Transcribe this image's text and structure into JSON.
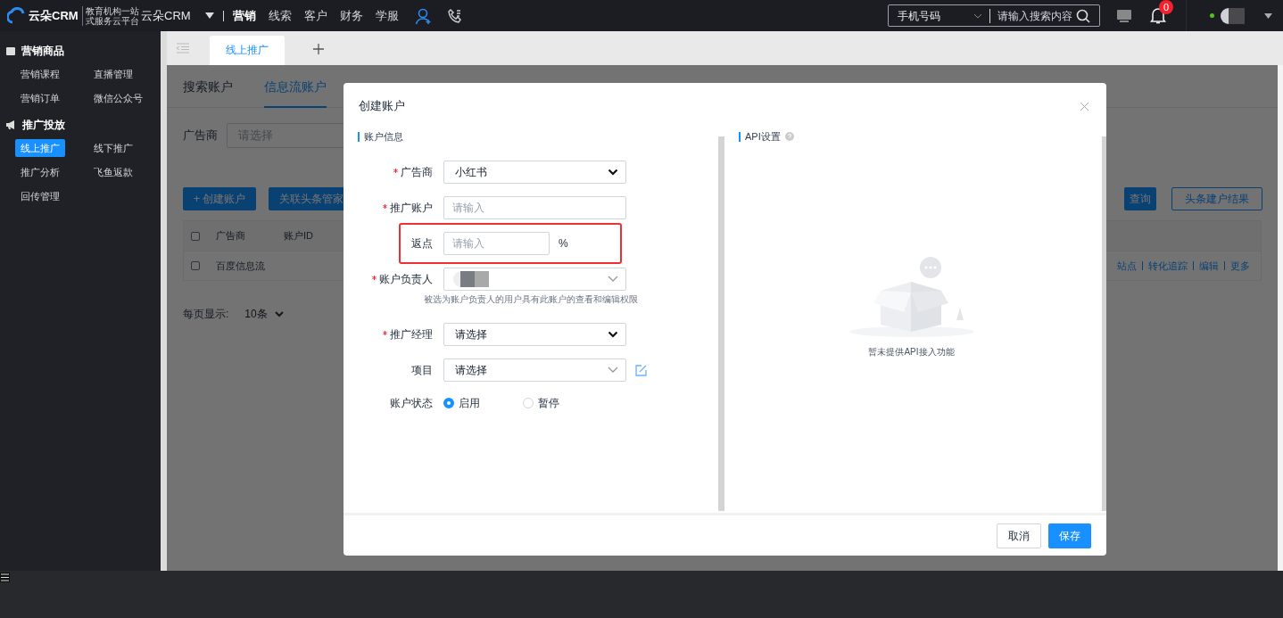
{
  "topbar": {
    "logo": "云朵CRM",
    "slogan": [
      "教育机构一站",
      "式服务云平台"
    ],
    "product": "云朵CRM",
    "nav": [
      {
        "label": "营销",
        "selected": true
      },
      {
        "label": "线索",
        "selected": false
      },
      {
        "label": "客户",
        "selected": false
      },
      {
        "label": "财务",
        "selected": false
      },
      {
        "label": "学服",
        "selected": false
      }
    ],
    "search": {
      "type": "手机号码",
      "placeholder": "请输入搜索内容"
    },
    "notifications": "0",
    "online": true
  },
  "sidebar": {
    "groups": [
      {
        "title": "营销商品",
        "items": [
          {
            "label": "营销课程",
            "selected": false
          },
          {
            "label": "直播管理",
            "selected": false
          },
          {
            "label": "营销订单",
            "selected": false
          },
          {
            "label": "微信公众号",
            "selected": false
          }
        ]
      },
      {
        "title": "推广投放",
        "items": [
          {
            "label": "线上推广",
            "selected": true
          },
          {
            "label": "线下推广",
            "selected": false
          },
          {
            "label": "推广分析",
            "selected": false
          },
          {
            "label": "飞鱼返款",
            "selected": false
          },
          {
            "label": "回传管理",
            "selected": false
          }
        ]
      }
    ]
  },
  "page_tabs": [
    {
      "label": "线上推广",
      "selected": true
    }
  ],
  "page": {
    "tabs": [
      {
        "label": "搜索账户",
        "selected": false
      },
      {
        "label": "信息流账户",
        "selected": true
      }
    ],
    "filter": {
      "label": "广告商",
      "placeholder": "请选择"
    },
    "left_buttons": [
      {
        "label": "+ 创建账户",
        "kind": "primary"
      },
      {
        "label": "关联头条管家",
        "kind": "primary"
      }
    ],
    "right_buttons": [
      {
        "label": "查询",
        "kind": "primary"
      },
      {
        "label": "头条建户结果",
        "kind": "outline"
      }
    ],
    "table": {
      "all_checked": false,
      "columns": [
        "广告商",
        "账户ID"
      ],
      "rows": [
        {
          "checked": false,
          "cells": [
            "百度信息流"
          ],
          "actions": [
            "站点",
            "转化追踪",
            "编辑",
            "更多"
          ]
        }
      ]
    },
    "page_size": {
      "label": "每页显示:",
      "value": "10条"
    }
  },
  "modal": {
    "title": "创建账户",
    "left_section": "账户信息",
    "right_section": "API设置",
    "fields": [
      {
        "kind": "select",
        "label": "广告商",
        "required": true,
        "value": "小红书"
      },
      {
        "kind": "input",
        "label": "推广账户",
        "required": true,
        "placeholder": "请输入"
      },
      {
        "kind": "input",
        "label": "返点",
        "required": false,
        "placeholder": "请输入",
        "suffix": "%",
        "highlighted": true
      },
      {
        "kind": "user",
        "label": "账户负责人",
        "required": true,
        "hint": "被选为账户负责人的用户具有此账户的查看和编辑权限"
      },
      {
        "kind": "select",
        "label": "推广经理",
        "required": true,
        "value": "请选择"
      },
      {
        "kind": "dropdown",
        "label": "项目",
        "required": false,
        "value": "请选择"
      },
      {
        "kind": "radio",
        "label": "账户状态",
        "required": false,
        "options": [
          {
            "label": "启用",
            "selected": true
          },
          {
            "label": "暂停",
            "selected": false
          }
        ]
      }
    ],
    "empty_text": "暂未提供API接入功能",
    "buttons": [
      {
        "label": "取消",
        "kind": "default"
      },
      {
        "label": "保存",
        "kind": "primary"
      }
    ]
  }
}
